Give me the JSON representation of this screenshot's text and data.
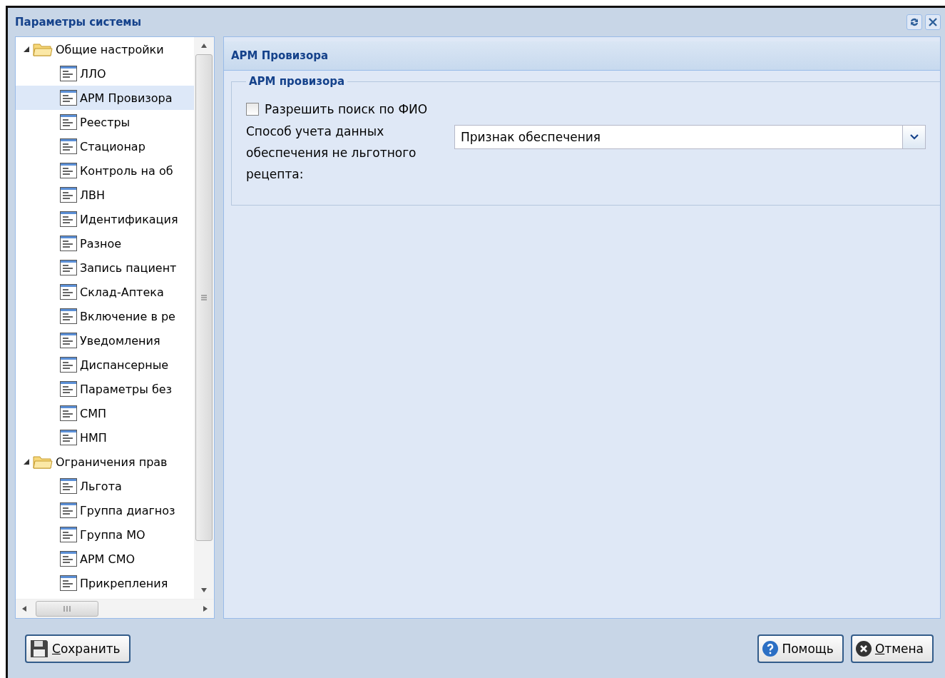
{
  "window": {
    "title": "Параметры системы"
  },
  "tree": [
    {
      "label": "Общие настройки",
      "expanded": true,
      "selected": false,
      "children": [
        {
          "label": "ЛЛО",
          "selected": false
        },
        {
          "label": "АРМ Провизора",
          "selected": true
        },
        {
          "label": "Реестры",
          "selected": false
        },
        {
          "label": "Стационар",
          "selected": false
        },
        {
          "label": "Контроль на об",
          "selected": false
        },
        {
          "label": "ЛВН",
          "selected": false
        },
        {
          "label": "Идентификация",
          "selected": false
        },
        {
          "label": "Разное",
          "selected": false
        },
        {
          "label": "Запись пациент",
          "selected": false
        },
        {
          "label": "Склад-Аптека",
          "selected": false
        },
        {
          "label": "Включение в ре",
          "selected": false
        },
        {
          "label": "Уведомления",
          "selected": false
        },
        {
          "label": "Диспансерные",
          "selected": false
        },
        {
          "label": "Параметры без",
          "selected": false
        },
        {
          "label": "СМП",
          "selected": false
        },
        {
          "label": "НМП",
          "selected": false
        }
      ]
    },
    {
      "label": "Ограничения прав",
      "expanded": true,
      "selected": false,
      "children": [
        {
          "label": "Льгота",
          "selected": false
        },
        {
          "label": "Группа диагноз",
          "selected": false
        },
        {
          "label": "Группа МО",
          "selected": false
        },
        {
          "label": "АРМ СМО",
          "selected": false
        },
        {
          "label": "Прикрепления",
          "selected": false
        }
      ]
    }
  ],
  "panel": {
    "title": "АРМ Провизора",
    "fieldset": {
      "legend": "АРМ провизора",
      "checkbox": {
        "label": "Разрешить поиск по ФИО",
        "checked": false
      },
      "combo": {
        "label": "Способ учета данных обеспечения не льготного рецепта:",
        "value": "Признак обеспечения"
      }
    }
  },
  "buttons": [
    {
      "kind": "save",
      "label": "Сохранить",
      "underline_first": true
    },
    {
      "kind": "help",
      "label": "Помощь",
      "underline_first": false
    },
    {
      "kind": "cancel",
      "label": "Отмена",
      "underline_first": true
    }
  ]
}
